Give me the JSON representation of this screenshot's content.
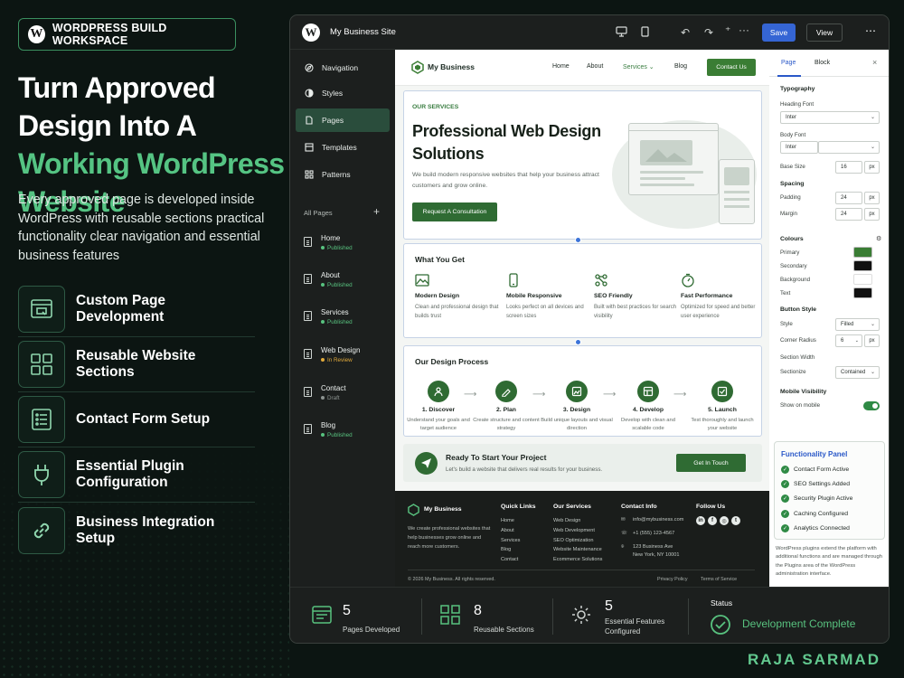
{
  "promo": {
    "badge": "WORDPRESS BUILD WORKSPACE",
    "headline_white": "Turn Approved Design Into A ",
    "headline_green": "Working WordPress Website",
    "description": "Every approved page is developed inside WordPress with reusable sections practical functionality clear navigation and essential business features",
    "features": [
      {
        "label": "Custom Page Development",
        "icon": "browser-window-icon"
      },
      {
        "label": "Reusable Website Sections",
        "icon": "grid-icon"
      },
      {
        "label": "Contact Form Setup",
        "icon": "form-list-icon"
      },
      {
        "label": "Essential Plugin Configuration",
        "icon": "plug-icon"
      },
      {
        "label": "Business Integration Setup",
        "icon": "link-icon"
      }
    ],
    "author": "RAJA SARMAD",
    "accent_color": "#55c483"
  },
  "editor": {
    "site_name": "My Business Site",
    "save_label": "Save",
    "view_label": "View",
    "save_color": "#3565d4",
    "sidebar": {
      "nav": [
        {
          "label": "Navigation",
          "icon": "navigation-icon"
        },
        {
          "label": "Styles",
          "icon": "styles-icon"
        },
        {
          "label": "Pages",
          "icon": "pages-icon",
          "active": true
        },
        {
          "label": "Templates",
          "icon": "templates-icon"
        },
        {
          "label": "Patterns",
          "icon": "patterns-icon"
        }
      ],
      "all_pages_label": "All Pages",
      "pages": [
        {
          "name": "Home",
          "status": "Published"
        },
        {
          "name": "About",
          "status": "Published"
        },
        {
          "name": "Services",
          "status": "Published"
        },
        {
          "name": "Web Design",
          "status": "In Review"
        },
        {
          "name": "Contact",
          "status": "Draft"
        },
        {
          "name": "Blog",
          "status": "Published"
        }
      ]
    },
    "site": {
      "brand": "My Business",
      "nav": [
        "Home",
        "About",
        "Services",
        "Blog"
      ],
      "cta": "Contact Us",
      "hero": {
        "eyebrow": "OUR SERVICES",
        "title": "Professional Web Design Solutions",
        "subtitle": "We build modern responsive websites that help your business attract customers and grow online.",
        "button": "Request A Consultation"
      },
      "what_you_get": {
        "title": "What You Get",
        "items": [
          {
            "title": "Modern Design",
            "desc": "Clean and professional design that builds trust",
            "icon": "image-icon"
          },
          {
            "title": "Mobile Responsive",
            "desc": "Looks perfect on all devices and screen sizes",
            "icon": "mobile-icon"
          },
          {
            "title": "SEO Friendly",
            "desc": "Built with best practices for search visibility",
            "icon": "nodes-icon"
          },
          {
            "title": "Fast Performance",
            "desc": "Optimized for speed and better user experience",
            "icon": "stopwatch-icon"
          }
        ]
      },
      "process": {
        "title": "Our Design Process",
        "steps": [
          {
            "title": "1. Discover",
            "desc": "Understand your goals and target audience"
          },
          {
            "title": "2. Plan",
            "desc": "Create structure and content strategy"
          },
          {
            "title": "3. Design",
            "desc": "Build unique layouts and visual direction"
          },
          {
            "title": "4. Develop",
            "desc": "Develop with clean and scalable code"
          },
          {
            "title": "5. Launch",
            "desc": "Test thoroughly and launch your website"
          }
        ]
      },
      "cta_band": {
        "title": "Ready To Start Your Project",
        "subtitle": "Let's build a website that delivers real results for your business.",
        "button": "Get In Touch"
      },
      "footer": {
        "brand": "My Business",
        "desc": "We create professional websites that help businesses grow online and reach more customers.",
        "quick_links_title": "Quick Links",
        "quick_links": [
          "Home",
          "About",
          "Services",
          "Blog",
          "Contact"
        ],
        "services_title": "Our Services",
        "services": [
          "Web Design",
          "Web Development",
          "SEO Optimization",
          "Website Maintenance",
          "Ecommerce Solutions"
        ],
        "contact_title": "Contact Info",
        "email": "info@mybusiness.com",
        "phone": "+1 (555) 123-4567",
        "address_line1": "123 Business Ave",
        "address_line2": "New York, NY 10001",
        "follow_title": "Follow Us",
        "copyright": "© 2026 My Business. All rights reserved.",
        "privacy": "Privacy Policy",
        "terms": "Terms of Service"
      }
    },
    "panel": {
      "tab_page": "Page",
      "tab_block": "Block",
      "typography": "Typography",
      "heading_font_label": "Heading Font",
      "heading_font": "Inter",
      "body_font_label": "Body Font",
      "body_font": "Inter",
      "base_size_label": "Base Size",
      "base_size": "16",
      "spacing": "Spacing",
      "padding_label": "Padding",
      "padding": "24",
      "margin_label": "Margin",
      "margin": "24",
      "unit": "px",
      "colours": "Colours",
      "colour_rows": [
        {
          "label": "Primary",
          "color": "#3a7d34"
        },
        {
          "label": "Secondary",
          "color": "#111111"
        },
        {
          "label": "Background",
          "color": "#ffffff"
        },
        {
          "label": "Text",
          "color": "#111111"
        }
      ],
      "button_style": "Button Style",
      "style_label": "Style",
      "style_value": "Filled",
      "corner_radius_label": "Corner Radius",
      "corner_radius": "6",
      "section_width_label": "Section Width",
      "sectionize_label": "Sectionize",
      "sectionize_value": "Contained",
      "mobile_visibility": "Mobile Visibility",
      "show_on_mobile": "Show on mobile",
      "functionality_title": "Functionality Panel",
      "functionality": [
        "Contact Form Active",
        "SEO Settings Added",
        "Security Plugin Active",
        "Caching Configured",
        "Analytics Connected"
      ],
      "note": "WordPress plugins extend the platform with additional functions and are managed through the Plugins area of the WordPress administration interface."
    },
    "stats": [
      {
        "value": "5",
        "label": "Pages Developed"
      },
      {
        "value": "8",
        "label": "Reusable Sections"
      },
      {
        "value": "5",
        "label": "Essential Features Configured"
      }
    ],
    "status_label": "Status",
    "status_value": "Development Complete"
  }
}
